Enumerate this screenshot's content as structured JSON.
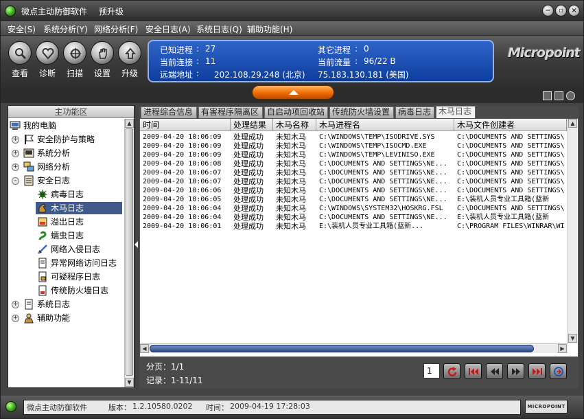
{
  "window": {
    "title": "微点主动防御软件",
    "upgrade_label": "预升级",
    "controls": [
      "minimize",
      "restore",
      "close"
    ]
  },
  "menu": [
    "安全(S)",
    "系统分析(Y)",
    "网络分析(F)",
    "安全日志(A)",
    "系统日志(Q)",
    "辅助功能(H)"
  ],
  "toolbar": {
    "buttons": [
      {
        "label": "查看",
        "icon": "magnifier-icon"
      },
      {
        "label": "诊断",
        "icon": "heart-icon"
      },
      {
        "label": "扫描",
        "icon": "scan-icon"
      },
      {
        "label": "设置",
        "icon": "hand-icon"
      },
      {
        "label": "升级",
        "icon": "upgrade-icon"
      }
    ]
  },
  "info": {
    "known_process_label": "已知进程",
    "known_process_value": "27",
    "other_process_label": "其它进程",
    "other_process_value": "0",
    "current_conn_label": "当前连接",
    "current_conn_value": "11",
    "current_traffic_label": "当前流量",
    "current_traffic_value": "96/22 B",
    "remote_label": "远端地址",
    "remote_addr1": "202.108.29.248 (北京)",
    "remote_addr2": "75.183.130.181 (美国)"
  },
  "logo": "Micropoint",
  "sidebar": {
    "header": "主功能区",
    "root": "我的电脑",
    "items": [
      {
        "label": "安全防护与策略",
        "icon": "flag-icon",
        "level": 1,
        "expander": "+"
      },
      {
        "label": "系统分析",
        "icon": "system-icon",
        "level": 1,
        "expander": "+"
      },
      {
        "label": "网络分析",
        "icon": "network-icon",
        "level": 1,
        "expander": "+"
      },
      {
        "label": "安全日志",
        "icon": "log-icon",
        "level": 1,
        "expander": "-"
      },
      {
        "label": "病毒日志",
        "icon": "virus-icon",
        "level": 2
      },
      {
        "label": "木马日志",
        "icon": "trojan-icon",
        "level": 2,
        "selected": true
      },
      {
        "label": "溢出日志",
        "icon": "overflow-icon",
        "level": 2
      },
      {
        "label": "蠕虫日志",
        "icon": "worm-icon",
        "level": 2
      },
      {
        "label": "网络入侵日志",
        "icon": "sword-icon",
        "level": 2
      },
      {
        "label": "异常网络访问日志",
        "icon": "doc-icon",
        "level": 2
      },
      {
        "label": "可疑程序日志",
        "icon": "doc-lock-icon",
        "level": 2
      },
      {
        "label": "传统防火墙日志",
        "icon": "firewall-icon",
        "level": 2
      },
      {
        "label": "系统日志",
        "icon": "doc-icon",
        "level": 1,
        "expander": "+"
      },
      {
        "label": "辅助功能",
        "icon": "tools-icon",
        "level": 1,
        "expander": "+"
      }
    ]
  },
  "tabs": [
    {
      "label": "进程综合信息"
    },
    {
      "label": "有害程序隔离区"
    },
    {
      "label": "自启动项回收站"
    },
    {
      "label": "传统防火墙设置"
    },
    {
      "label": "病毒日志"
    },
    {
      "label": "木马日志",
      "active": true
    }
  ],
  "table": {
    "columns": [
      "时间",
      "处理结果",
      "木马名称",
      "木马进程名",
      "木马文件创建者"
    ],
    "rows": [
      [
        "2009-04-20 10:06:09",
        "处理成功",
        "未知木马",
        "C:\\WINDOWS\\TEMP\\ISODRIVE.SYS",
        "C:\\DOCUMENTS AND SETTINGS\\"
      ],
      [
        "2009-04-20 10:06:09",
        "处理成功",
        "未知木马",
        "C:\\WINDOWS\\TEMP\\ISOCMD.EXE",
        "C:\\DOCUMENTS AND SETTINGS\\"
      ],
      [
        "2009-04-20 10:06:09",
        "处理成功",
        "未知木马",
        "C:\\WINDOWS\\TEMP\\LEVINISO.EXE",
        "C:\\DOCUMENTS AND SETTINGS\\"
      ],
      [
        "2009-04-20 10:06:08",
        "处理成功",
        "未知木马",
        "C:\\DOCUMENTS AND SETTINGS\\NE...",
        "C:\\DOCUMENTS AND SETTINGS\\"
      ],
      [
        "2009-04-20 10:06:07",
        "处理成功",
        "未知木马",
        "C:\\DOCUMENTS AND SETTINGS\\NE...",
        "C:\\DOCUMENTS AND SETTINGS\\"
      ],
      [
        "2009-04-20 10:06:07",
        "处理成功",
        "未知木马",
        "C:\\DOCUMENTS AND SETTINGS\\NE...",
        "C:\\DOCUMENTS AND SETTINGS\\"
      ],
      [
        "2009-04-20 10:06:06",
        "处理成功",
        "未知木马",
        "C:\\DOCUMENTS AND SETTINGS\\NE...",
        "C:\\DOCUMENTS AND SETTINGS\\"
      ],
      [
        "2009-04-20 10:06:05",
        "处理成功",
        "未知木马",
        "C:\\DOCUMENTS AND SETTINGS\\NE...",
        "E:\\装机人员专业工具箱(蓝新"
      ],
      [
        "2009-04-20 10:06:04",
        "处理成功",
        "未知木马",
        "C:\\WINDOWS\\SYSTEM32\\HOSKRG.FSL",
        "C:\\DOCUMENTS AND SETTINGS\\"
      ],
      [
        "2009-04-20 10:06:04",
        "处理成功",
        "未知木马",
        "C:\\DOCUMENTS AND SETTINGS\\NE...",
        "E:\\装机人员专业工具箱(蓝新"
      ],
      [
        "2009-04-20 10:06:01",
        "处理成功",
        "未知木马",
        "E:\\装机人员专业工具箱(蓝新...",
        "C:\\PROGRAM FILES\\WINRAR\\WI"
      ]
    ]
  },
  "pager": {
    "page_info": "分页：1/1",
    "records_info": "记录：1-11/11",
    "page_input": "1",
    "buttons": [
      "refresh-icon",
      "first-page-icon",
      "prev-page-icon",
      "next-page-icon",
      "last-page-icon",
      "export-icon"
    ]
  },
  "status": {
    "product": "微点主动防御软件",
    "version_label": "版本：",
    "version": "1.2.10580.0202",
    "time_label": "时间：",
    "time": "2009-04-19 17:28:03",
    "brand": "MICROPOINT"
  }
}
